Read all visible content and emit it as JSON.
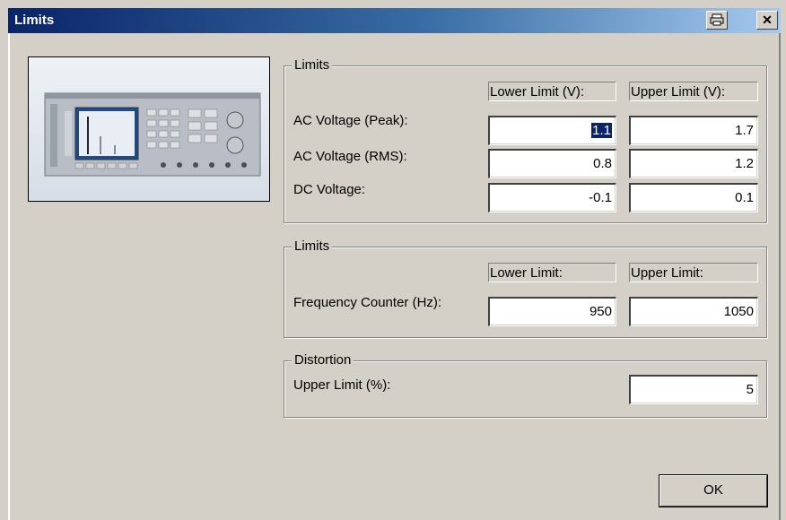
{
  "window": {
    "title": "Limits"
  },
  "voltage_group": {
    "legend": "Limits",
    "lower_header": "Lower Limit (V):",
    "upper_header": "Upper Limit (V):",
    "rows": [
      {
        "label": "AC Voltage (Peak):",
        "lower": "1.1",
        "upper": "1.7"
      },
      {
        "label": "AC Voltage (RMS):",
        "lower": "0.8",
        "upper": "1.2"
      },
      {
        "label": "DC Voltage:",
        "lower": "-0.1",
        "upper": "0.1"
      }
    ]
  },
  "frequency_group": {
    "legend": "Limits",
    "lower_header": "Lower Limit:",
    "upper_header": "Upper Limit:",
    "label": "Frequency Counter (Hz):",
    "lower": "950",
    "upper": "1050"
  },
  "distortion_group": {
    "legend": "Distortion",
    "label": "Upper Limit (%):",
    "upper": "5"
  },
  "buttons": {
    "ok": "OK"
  },
  "icons": {
    "print": "print-icon",
    "close": "close-icon"
  }
}
